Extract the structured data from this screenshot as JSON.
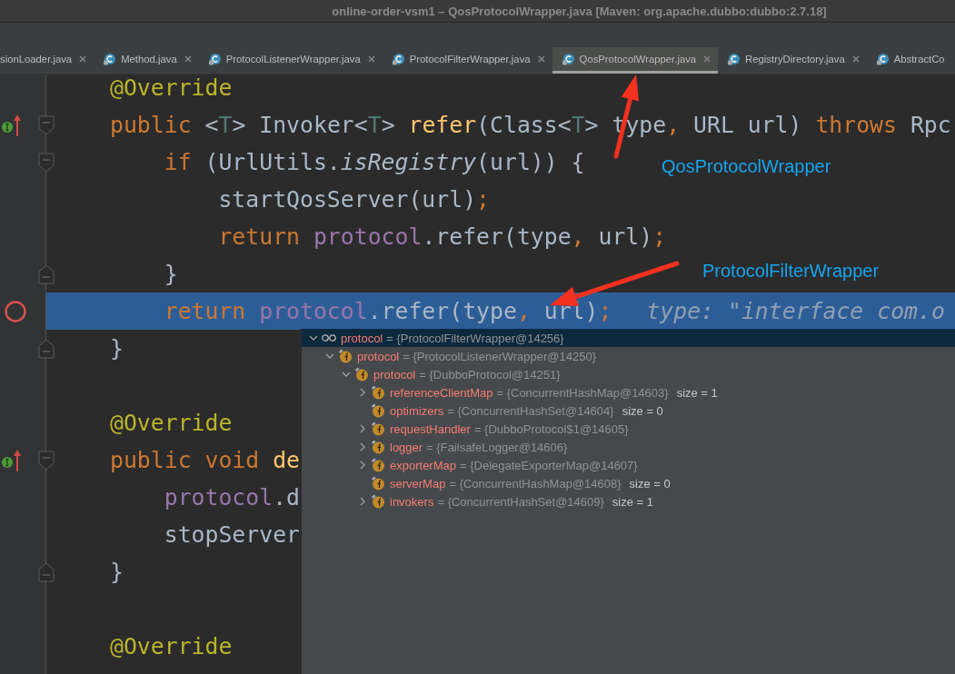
{
  "window": {
    "title": "online-order-vsm1 – QosProtocolWrapper.java [Maven: org.apache.dubbo:dubbo:2.7.18]"
  },
  "tabs": [
    {
      "label": "sionLoader.java",
      "kind": "cut",
      "closable": true,
      "selected": false
    },
    {
      "label": "Method.java",
      "kind": "class",
      "closable": true,
      "selected": false
    },
    {
      "label": "ProtocolListenerWrapper.java",
      "kind": "class",
      "closable": true,
      "selected": false
    },
    {
      "label": "ProtocolFilterWrapper.java",
      "kind": "class",
      "closable": true,
      "selected": false
    },
    {
      "label": "QosProtocolWrapper.java",
      "kind": "class",
      "closable": true,
      "selected": true
    },
    {
      "label": "RegistryDirectory.java",
      "kind": "class",
      "closable": true,
      "selected": false
    },
    {
      "label": "AbstractCo",
      "kind": "class",
      "closable": false,
      "selected": false
    }
  ],
  "editor": {
    "lines": [
      {
        "kind": "code",
        "current": false,
        "tokens": [
          {
            "kind": "ann",
            "text": "@Override"
          }
        ]
      },
      {
        "kind": "code",
        "current": false,
        "gutter_marker": {
          "kind": "implements"
        },
        "fold_marker": {
          "kind": "start"
        },
        "tokens": [
          {
            "kind": "kw",
            "text": "public "
          },
          {
            "kind": "txt",
            "text": "<"
          },
          {
            "kind": "tp",
            "text": "T"
          },
          {
            "kind": "txt",
            "text": "> Invoker<"
          },
          {
            "kind": "tp",
            "text": "T"
          },
          {
            "kind": "txt",
            "text": "> "
          },
          {
            "kind": "fn",
            "text": "refer"
          },
          {
            "kind": "txt",
            "text": "(Class<"
          },
          {
            "kind": "tp",
            "text": "T"
          },
          {
            "kind": "txt",
            "text": "> type"
          },
          {
            "kind": "punct",
            "text": ", "
          },
          {
            "kind": "txt",
            "text": "URL url) "
          },
          {
            "kind": "kw",
            "text": "throws "
          },
          {
            "kind": "txt",
            "text": "Rpc"
          }
        ],
        "children": [
          {
            "kind": "code",
            "current": false,
            "fold_marker": {
              "kind": "start"
            },
            "tokens": [
              {
                "kind": "kw",
                "text": "if "
              },
              {
                "kind": "txt",
                "text": "(UrlUtils."
              },
              {
                "kind": "static",
                "text": "isRegistry"
              },
              {
                "kind": "txt",
                "text": "(url)) {"
              }
            ],
            "children": [
              {
                "kind": "code",
                "current": false,
                "tokens": [
                  {
                    "kind": "txt",
                    "text": "startQosServer(url)"
                  },
                  {
                    "kind": "punct",
                    "text": ";"
                  }
                ]
              },
              {
                "kind": "code",
                "current": false,
                "tokens": [
                  {
                    "kind": "kw",
                    "text": "return "
                  },
                  {
                    "kind": "fld",
                    "text": "protocol"
                  },
                  {
                    "kind": "txt",
                    "text": ".refer(type"
                  },
                  {
                    "kind": "punct",
                    "text": ", "
                  },
                  {
                    "kind": "txt",
                    "text": "url)"
                  },
                  {
                    "kind": "punct",
                    "text": ";"
                  }
                ]
              }
            ]
          },
          {
            "kind": "code",
            "current": false,
            "fold_marker": {
              "kind": "end"
            },
            "tokens": [
              {
                "kind": "txt",
                "text": "}"
              }
            ]
          },
          {
            "kind": "code",
            "current": true,
            "gutter_marker": {
              "kind": "breakpoint"
            },
            "hint": "type: \"interface com.o",
            "tokens": [
              {
                "kind": "kw",
                "text": "return "
              },
              {
                "kind": "fld",
                "text": "protocol"
              },
              {
                "kind": "txt",
                "text": ".refer(type"
              },
              {
                "kind": "punct",
                "text": ", "
              },
              {
                "kind": "txt",
                "text": "url)"
              },
              {
                "kind": "punct",
                "text": ";"
              }
            ]
          }
        ]
      },
      {
        "kind": "code",
        "current": false,
        "fold_marker": {
          "kind": "end"
        },
        "tokens": [
          {
            "kind": "txt",
            "text": "}"
          }
        ]
      },
      {
        "kind": "blank",
        "current": false
      },
      {
        "kind": "code",
        "current": false,
        "tokens": [
          {
            "kind": "ann",
            "text": "@Override"
          }
        ]
      },
      {
        "kind": "code",
        "current": false,
        "gutter_marker": {
          "kind": "implements"
        },
        "fold_marker": {
          "kind": "start"
        },
        "tokens": [
          {
            "kind": "kw",
            "text": "public "
          },
          {
            "kind": "kw",
            "text": "void "
          },
          {
            "kind": "fn",
            "text": "de"
          }
        ],
        "children": [
          {
            "kind": "code",
            "current": false,
            "tokens": [
              {
                "kind": "fld",
                "text": "protocol"
              },
              {
                "kind": "txt",
                "text": ".d"
              }
            ]
          },
          {
            "kind": "code",
            "current": false,
            "tokens": [
              {
                "kind": "txt",
                "text": "stopServer"
              }
            ]
          }
        ]
      },
      {
        "kind": "code",
        "current": false,
        "fold_marker": {
          "kind": "end"
        },
        "tokens": [
          {
            "kind": "txt",
            "text": "}"
          }
        ]
      },
      {
        "kind": "blank",
        "current": false
      },
      {
        "kind": "code",
        "current": false,
        "tokens": [
          {
            "kind": "ann",
            "text": "@Override"
          }
        ]
      }
    ]
  },
  "debugger_popup": {
    "tree": [
      {
        "kind": "watch",
        "expanded": true,
        "selected": true,
        "name": "protocol",
        "value": "= {ProtocolFilterWrapper@14256}",
        "children": [
          {
            "kind": "field",
            "expanded": true,
            "selected": false,
            "name": "protocol",
            "value": "= {ProtocolListenerWrapper@14250}",
            "children": [
              {
                "kind": "field",
                "expanded": true,
                "selected": false,
                "name": "protocol",
                "value": "= {DubboProtocol@14251}",
                "children": [
                  {
                    "kind": "field",
                    "expanded": false,
                    "selected": false,
                    "name": "referenceClientMap",
                    "value": "= {ConcurrentHashMap@14603}",
                    "size": "size = 1"
                  },
                  {
                    "kind": "field",
                    "selected": false,
                    "name": "optimizers",
                    "value": "= {ConcurrentHashSet@14604}",
                    "size": "size = 0"
                  },
                  {
                    "kind": "field",
                    "expanded": false,
                    "selected": false,
                    "name": "requestHandler",
                    "value": "= {DubboProtocol$1@14605}"
                  },
                  {
                    "kind": "field",
                    "expanded": false,
                    "selected": false,
                    "name": "logger",
                    "value": "= {FailsafeLogger@14606}"
                  },
                  {
                    "kind": "field",
                    "expanded": false,
                    "selected": false,
                    "name": "exporterMap",
                    "value": "= {DelegateExporterMap@14607}"
                  },
                  {
                    "kind": "field",
                    "selected": false,
                    "name": "serverMap",
                    "value": "= {ConcurrentHashMap@14608}",
                    "size": "size = 0"
                  },
                  {
                    "kind": "field",
                    "expanded": false,
                    "selected": false,
                    "name": "invokers",
                    "value": "= {ConcurrentHashSet@14609}",
                    "size": "size = 1"
                  }
                ]
              }
            ]
          }
        ]
      }
    ]
  },
  "annotations": [
    {
      "text": "QosProtocolWrapper"
    },
    {
      "text": "ProtocolFilterWrapper"
    }
  ]
}
